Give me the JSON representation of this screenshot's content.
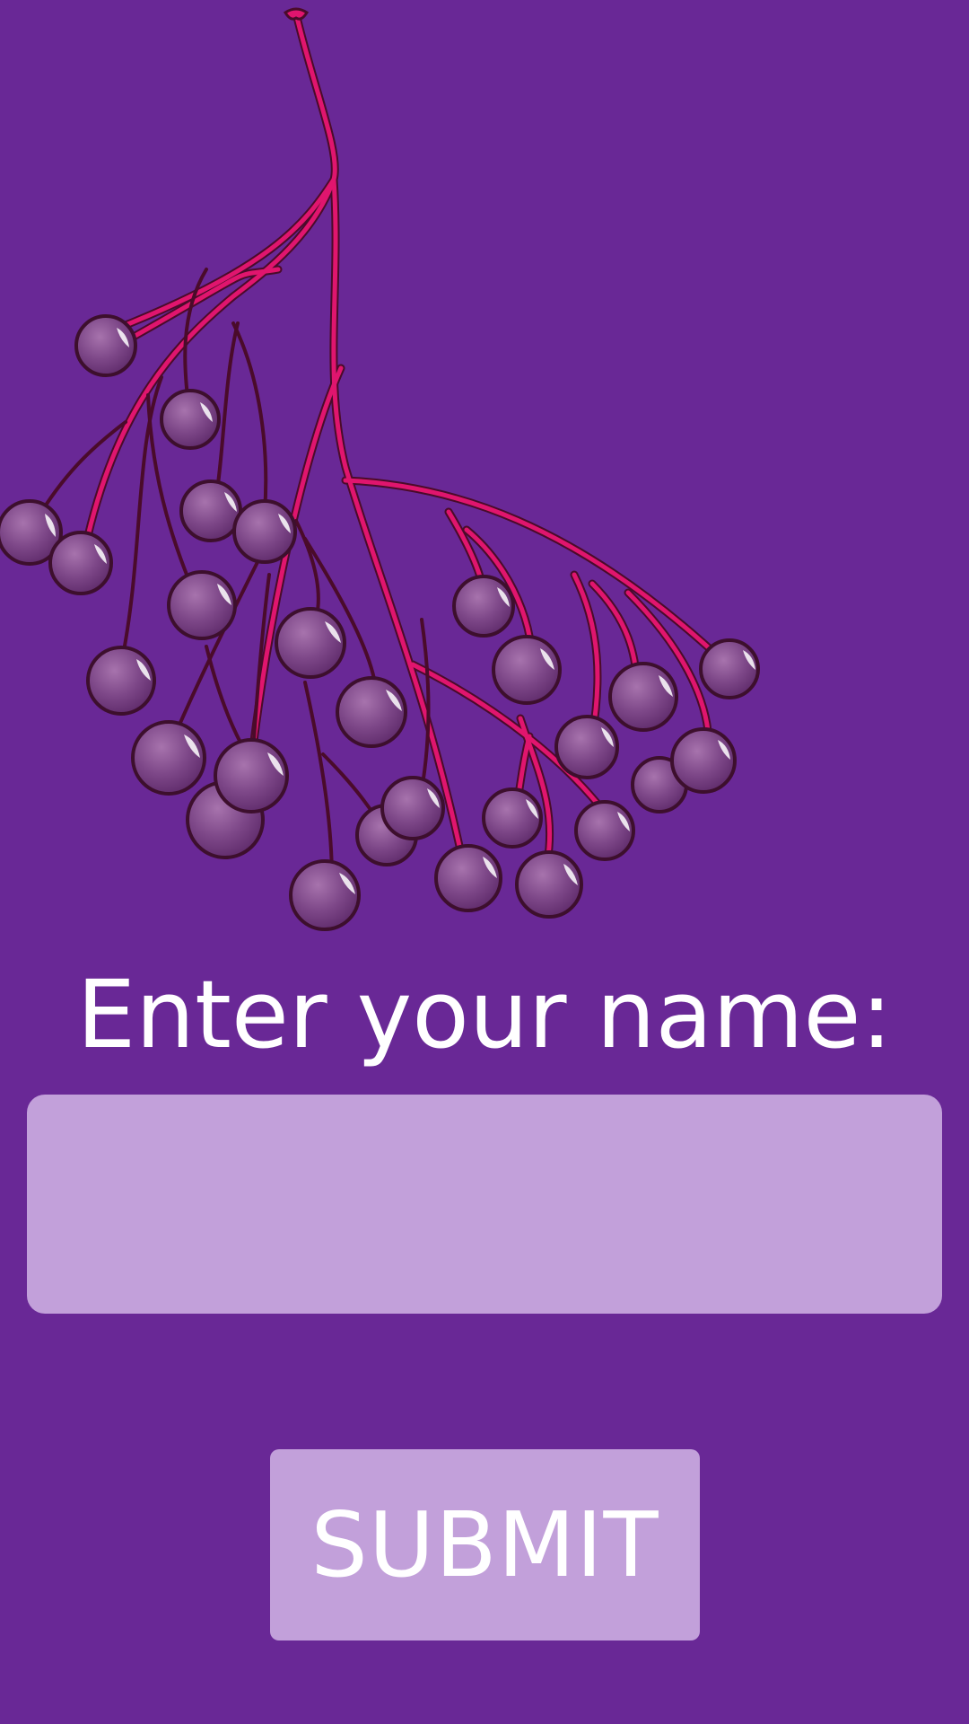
{
  "illustration": {
    "icon": "elderberry-branch-illustration",
    "colors": {
      "background": "#692896",
      "stem": "#e0156e",
      "stem_outline": "#4a0b2a",
      "berry": "#7a4585",
      "berry_light": "#9b62a1",
      "berry_outline": "#3d0f2d",
      "highlight": "#ffffff"
    }
  },
  "form": {
    "prompt": "Enter your name:",
    "name_input": {
      "value": "",
      "placeholder": ""
    },
    "submit_label": "SUBMIT"
  },
  "colors": {
    "background": "#692896",
    "field": "#c2a0da",
    "text": "#ffffff"
  }
}
